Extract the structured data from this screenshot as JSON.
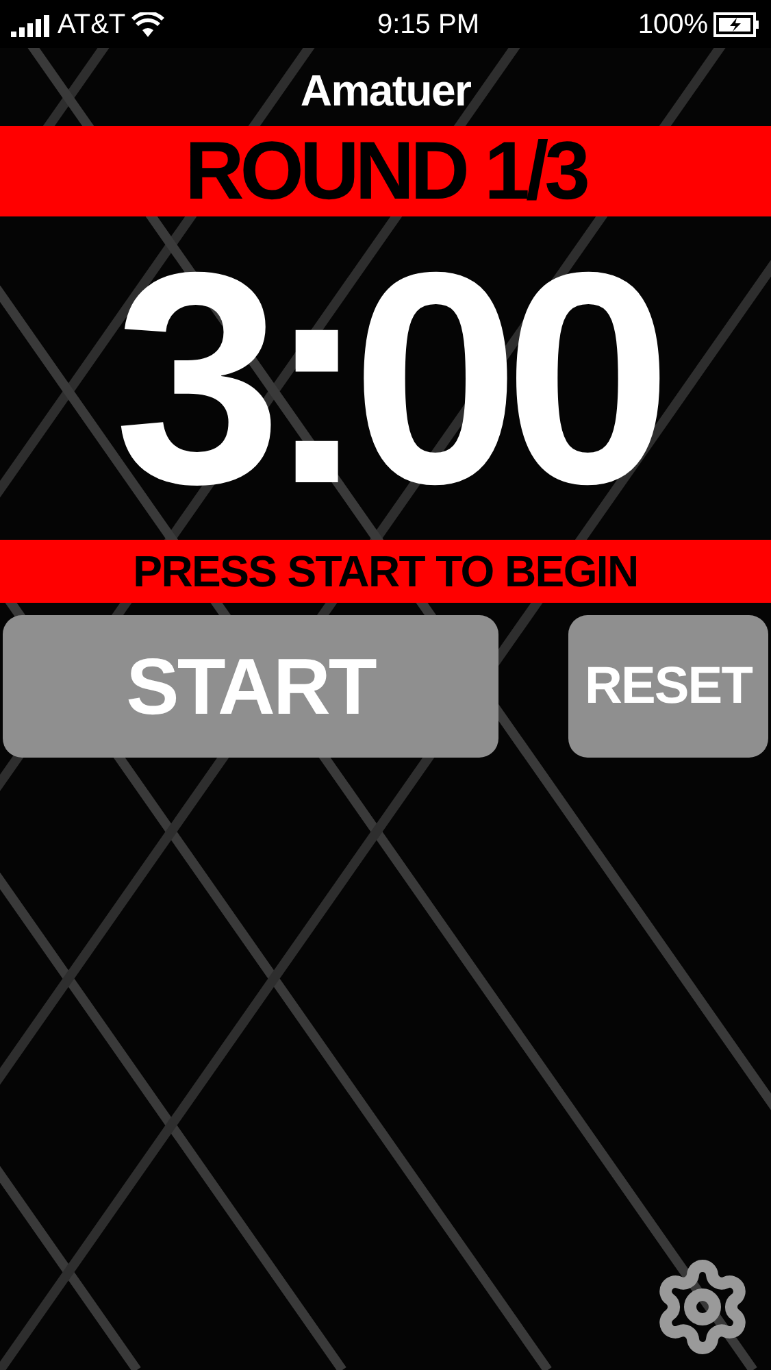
{
  "status_bar": {
    "carrier": "AT&T",
    "time": "9:15 PM",
    "battery": "100%"
  },
  "title": "Amatuer",
  "round_banner": "ROUND 1/3",
  "timer": "3:00",
  "prompt": "PRESS START TO BEGIN",
  "buttons": [
    {
      "label": "START",
      "kind": "start"
    },
    {
      "label": "RESET",
      "kind": "reset"
    }
  ]
}
